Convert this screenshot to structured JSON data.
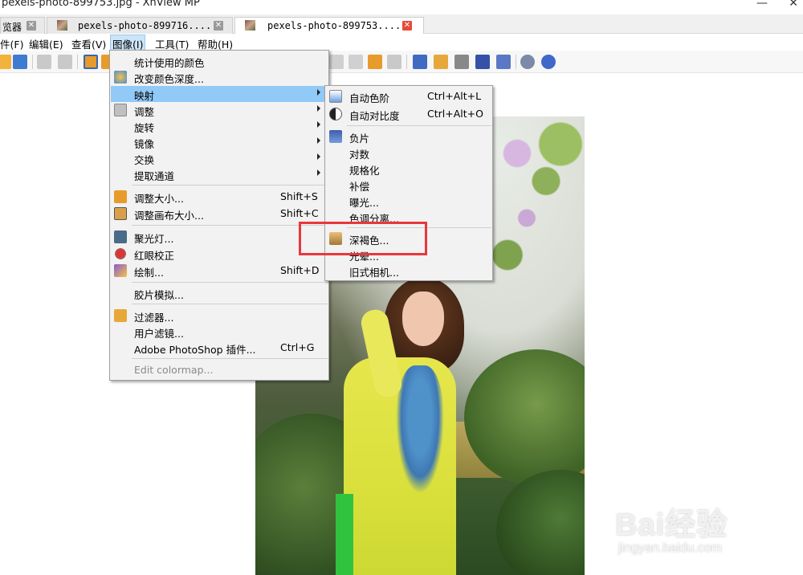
{
  "window": {
    "title": "pexels-photo-899753.jpg - XnView MP",
    "minimize_glyph": "—",
    "close_glyph": "✕"
  },
  "tabs": [
    {
      "label": "览器"
    },
    {
      "label": "pexels-photo-899716...."
    },
    {
      "label": "pexels-photo-899753...."
    }
  ],
  "menubar": {
    "items": [
      "件(F)",
      "编辑(E)",
      "查看(V)",
      "图像(I)",
      "工具(T)",
      "帮助(H)"
    ]
  },
  "image_menu": {
    "items": [
      {
        "label": "统计使用的颜色",
        "shortcut": ""
      },
      {
        "label": "改变颜色深度...",
        "shortcut": ""
      },
      {
        "label": "映射",
        "shortcut": ""
      },
      {
        "label": "调整",
        "shortcut": ""
      },
      {
        "label": "旋转",
        "shortcut": ""
      },
      {
        "label": "镜像",
        "shortcut": ""
      },
      {
        "label": "交换",
        "shortcut": ""
      },
      {
        "label": "提取通道",
        "shortcut": ""
      },
      {
        "label": "调整大小...",
        "shortcut": "Shift+S"
      },
      {
        "label": "调整画布大小...",
        "shortcut": "Shift+C"
      },
      {
        "label": "聚光灯...",
        "shortcut": ""
      },
      {
        "label": "红眼校正",
        "shortcut": ""
      },
      {
        "label": "绘制...",
        "shortcut": "Shift+D"
      },
      {
        "label": "胶片模拟...",
        "shortcut": ""
      },
      {
        "label": "过滤器...",
        "shortcut": ""
      },
      {
        "label": "用户滤镜...",
        "shortcut": ""
      },
      {
        "label": "Adobe PhotoShop 插件...",
        "shortcut": "Ctrl+G"
      },
      {
        "label": "Edit colormap...",
        "shortcut": ""
      }
    ]
  },
  "map_submenu": {
    "items": [
      {
        "label": "自动色阶",
        "shortcut": "Ctrl+Alt+L"
      },
      {
        "label": "自动对比度",
        "shortcut": "Ctrl+Alt+O"
      },
      {
        "label": "负片",
        "shortcut": ""
      },
      {
        "label": "对数",
        "shortcut": ""
      },
      {
        "label": "规格化",
        "shortcut": ""
      },
      {
        "label": "补偿",
        "shortcut": ""
      },
      {
        "label": "曝光...",
        "shortcut": ""
      },
      {
        "label": "色调分离...",
        "shortcut": ""
      },
      {
        "label": "深褐色...",
        "shortcut": ""
      },
      {
        "label": "光晕...",
        "shortcut": ""
      },
      {
        "label": "旧式相机...",
        "shortcut": ""
      }
    ]
  },
  "watermark": {
    "brand": "Bai经验",
    "url": "jingyan.baidu.com"
  },
  "colors": {
    "highlight": "#91c9f7",
    "annotation": "#e8383d",
    "active_tab_close": "#e64a3b"
  }
}
